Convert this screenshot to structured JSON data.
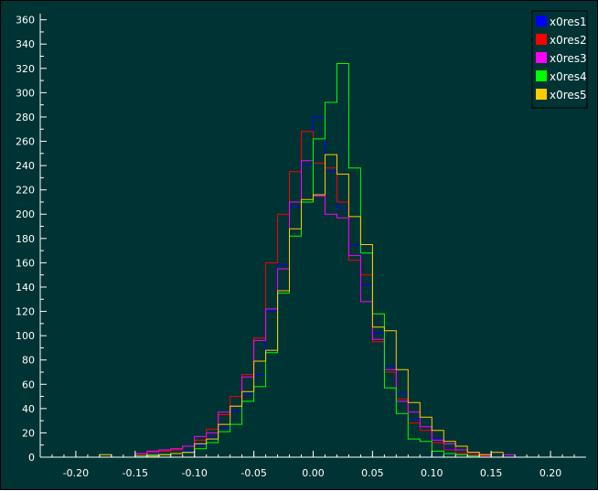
{
  "chart_data": {
    "type": "histogram",
    "title": "",
    "xlabel": "",
    "ylabel": "",
    "xlim": [
      -0.23,
      0.23
    ],
    "ylim": [
      0,
      365
    ],
    "grid": false,
    "legend_position": "top-right",
    "background_color": "#003333",
    "axis_color": "#ffffff",
    "x_ticks": [
      -0.2,
      -0.15,
      -0.1,
      -0.05,
      0.0,
      0.05,
      0.1,
      0.15,
      0.2
    ],
    "x_tick_labels": [
      "-0.20",
      "-0.15",
      "-0.10",
      "-0.05",
      "0.00",
      "0.05",
      "0.10",
      "0.15",
      "0.20"
    ],
    "y_ticks": [
      0,
      20,
      40,
      60,
      80,
      100,
      120,
      140,
      160,
      180,
      200,
      220,
      240,
      260,
      280,
      300,
      320,
      340,
      360
    ],
    "y_tick_labels": [
      "0",
      "20",
      "40",
      "60",
      "80",
      "100",
      "120",
      "140",
      "160",
      "180",
      "200",
      "220",
      "240",
      "260",
      "280",
      "300",
      "320",
      "340",
      "360"
    ],
    "bin_edges": [
      -0.18,
      -0.17,
      -0.16,
      -0.15,
      -0.14,
      -0.13,
      -0.12,
      -0.11,
      -0.1,
      -0.09,
      -0.08,
      -0.07,
      -0.06,
      -0.05,
      -0.04,
      -0.03,
      -0.02,
      -0.01,
      0.0,
      0.01,
      0.02,
      0.03,
      0.04,
      0.05,
      0.06,
      0.07,
      0.08,
      0.09,
      0.1,
      0.11,
      0.12,
      0.13,
      0.14,
      0.15,
      0.16,
      0.17
    ],
    "series": [
      {
        "name": "x0res1",
        "color": "#0000ff",
        "values": [
          0,
          0,
          0,
          1,
          3,
          2,
          3,
          5,
          10,
          16,
          24,
          38,
          52,
          68,
          120,
          158,
          206,
          240,
          280,
          235,
          205,
          175,
          142,
          102,
          75,
          52,
          32,
          25,
          15,
          7,
          3,
          2,
          1,
          0,
          0
        ]
      },
      {
        "name": "x0res2",
        "color": "#ff0000",
        "values": [
          0,
          0,
          0,
          2,
          4,
          5,
          6,
          9,
          14,
          23,
          35,
          50,
          68,
          98,
          160,
          200,
          235,
          268,
          242,
          238,
          210,
          162,
          150,
          95,
          70,
          48,
          28,
          22,
          12,
          6,
          3,
          2,
          1,
          0,
          0
        ]
      },
      {
        "name": "x0res3",
        "color": "#ff00ff",
        "values": [
          0,
          0,
          0,
          3,
          5,
          6,
          7,
          9,
          17,
          20,
          37,
          42,
          66,
          96,
          122,
          155,
          210,
          244,
          215,
          200,
          197,
          166,
          128,
          97,
          72,
          46,
          37,
          25,
          14,
          11,
          6,
          4,
          2,
          0,
          2
        ]
      },
      {
        "name": "x0res4",
        "color": "#00ff00",
        "values": [
          0,
          0,
          0,
          1,
          2,
          2,
          3,
          4,
          7,
          12,
          21,
          27,
          46,
          58,
          86,
          135,
          182,
          210,
          262,
          292,
          324,
          238,
          168,
          118,
          57,
          36,
          15,
          13,
          5,
          3,
          2,
          1,
          0,
          0,
          0
        ]
      },
      {
        "name": "x0res5",
        "color": "#ffcc00",
        "values": [
          2,
          0,
          0,
          0,
          1,
          2,
          3,
          4,
          11,
          15,
          27,
          42,
          54,
          79,
          88,
          137,
          188,
          212,
          216,
          249,
          233,
          198,
          175,
          107,
          104,
          72,
          45,
          33,
          22,
          13,
          9,
          4,
          2,
          4,
          0
        ]
      }
    ]
  }
}
